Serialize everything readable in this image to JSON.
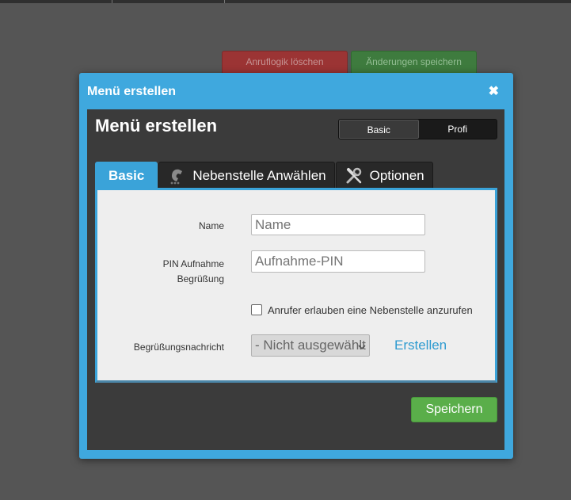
{
  "background": {
    "button_left_label": "Anruflogik löschen",
    "button_right_label": "Änderungen speichern"
  },
  "dialog": {
    "title": "Menü erstellen",
    "close_glyph": "✖",
    "heading": "Menü erstellen",
    "mode_switch": {
      "basic": "Basic",
      "profi": "Profi",
      "selected": "Profi"
    },
    "tabs": [
      {
        "label": "Basic",
        "active": true,
        "icon": ""
      },
      {
        "label": "Nebenstelle Anwählen",
        "active": false,
        "icon": "dial-icon"
      },
      {
        "label": "Optionen",
        "active": false,
        "icon": "tools-icon"
      }
    ],
    "form": {
      "name_label": "Name",
      "name_placeholder": "Name",
      "name_value": "",
      "pin_label_line1": "PIN Aufnahme",
      "pin_label_line2": "Begrüßung",
      "pin_placeholder": "Aufnahme-PIN",
      "pin_value": "",
      "allow_extension_label": "Anrufer erlauben eine Nebenstelle anzurufen",
      "allow_extension_checked": false,
      "greeting_label": "Begrüßungsnachricht",
      "greeting_selected": "- Nicht ausgewählt -",
      "create_link": "Erstellen"
    },
    "save_label": "Speichern"
  },
  "colors": {
    "accent": "#3fa8de",
    "save_green": "#5aae4a",
    "link_blue": "#2e9bd0"
  }
}
